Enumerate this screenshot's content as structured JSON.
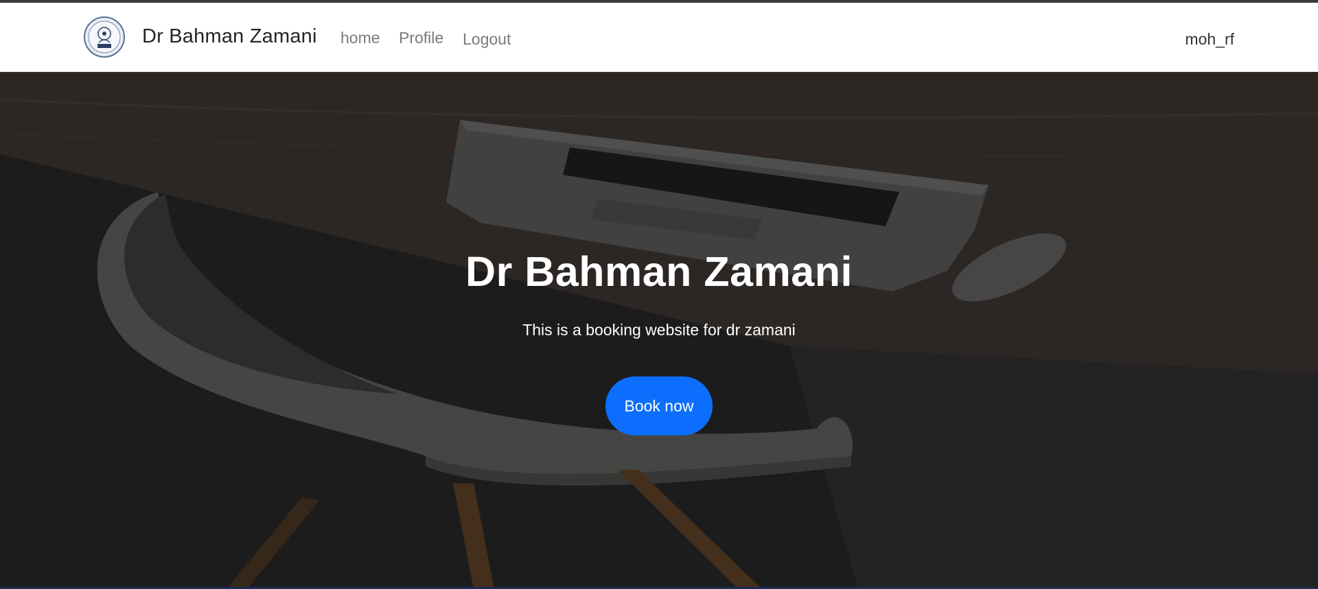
{
  "navbar": {
    "brand": "Dr Bahman Zamani",
    "links": [
      {
        "label": "home"
      },
      {
        "label": "Profile"
      },
      {
        "label": "Logout"
      }
    ],
    "username": "moh_rf",
    "logo_icon": "university-emblem-icon"
  },
  "hero": {
    "title": "Dr Bahman Zamani",
    "subtitle": "This is a booking website for dr zamani",
    "cta_label": "Book now",
    "background_icon": "desk-laptop-chair-photo"
  },
  "colors": {
    "accent": "#0d6efd",
    "navbar_bg": "#ffffff",
    "hero_overlay": "#2a2a2a"
  }
}
